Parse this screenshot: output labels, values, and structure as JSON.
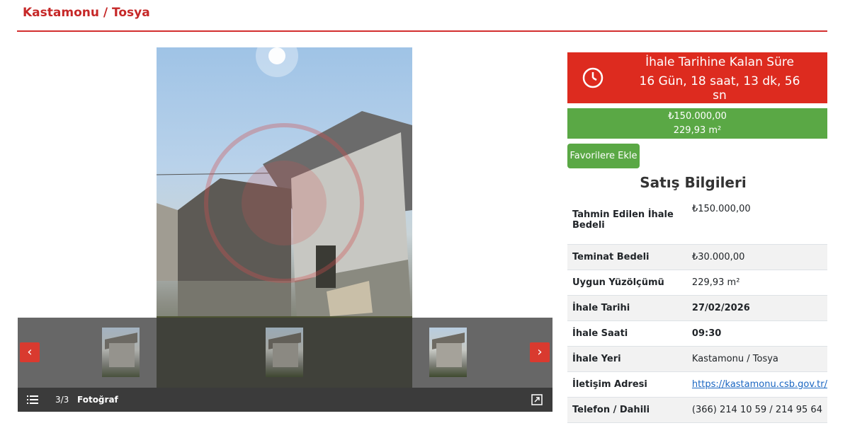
{
  "header": {
    "breadcrumb": "Kastamonu / Tosya"
  },
  "gallery": {
    "counter": "3/3",
    "label": "Fotoğraf",
    "thumbnail_count": 3,
    "active_thumbnail": 3,
    "icons": {
      "prev": "chevron-left-icon",
      "next": "chevron-right-icon",
      "list": "list-icon",
      "expand": "expand-icon"
    }
  },
  "timer": {
    "title": "İhale Tarihine Kalan Süre",
    "value": "16 Gün, 18 saat, 13 dk, 56 sn"
  },
  "price_box": {
    "price": "₺150.000,00",
    "area": "229,93 m²"
  },
  "favorite_button": "Favorilere Ekle",
  "sale_info": {
    "title": "Satış Bilgileri",
    "rows": [
      {
        "label": "Tahmin Edilen İhale Bedeli",
        "value": "₺150.000,00"
      },
      {
        "label": "Teminat Bedeli",
        "value": "₺30.000,00"
      },
      {
        "label": "Uygun Yüzölçümü",
        "value": "229,93 m²"
      },
      {
        "label": "İhale Tarihi",
        "value": "27/02/2026"
      },
      {
        "label": "İhale Saati",
        "value": "09:30"
      },
      {
        "label": "İhale Yeri",
        "value": "Kastamonu / Tosya"
      },
      {
        "label": "İletişim Adresi",
        "value": "https://kastamonu.csb.gov.tr/"
      },
      {
        "label": "Telefon / Dahili",
        "value": "(366) 214 10 59 / 214 95 64"
      }
    ]
  },
  "colors": {
    "accent_red": "#dd2b1f",
    "price_green": "#5aa845",
    "link_blue": "#1a66c2"
  }
}
